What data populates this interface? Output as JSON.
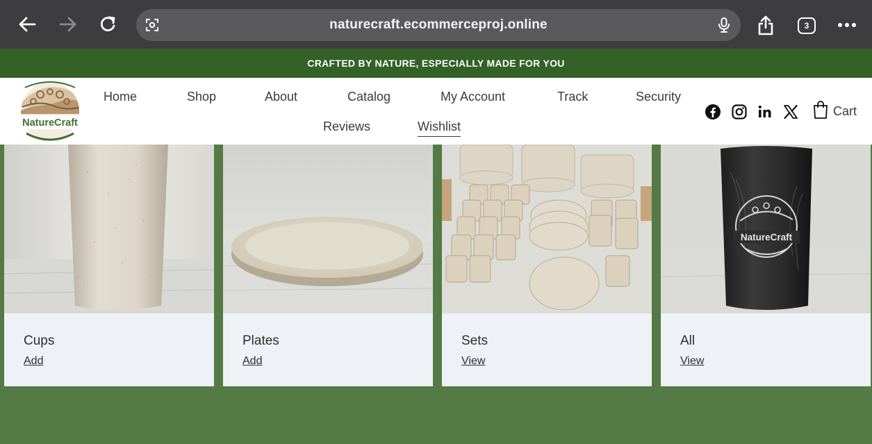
{
  "browser": {
    "url": "naturecraft.ecommerceproj.online",
    "tab_count": "3",
    "icons": [
      "back-arrow-icon",
      "forward-arrow-icon",
      "reload-icon",
      "site-settings-icon",
      "microphone-icon",
      "share-icon",
      "tabs-icon",
      "more-icon"
    ]
  },
  "announcement": {
    "text": "CRAFTED BY NATURE, ESPECIALLY MADE FOR YOU",
    "background": "#336128"
  },
  "header": {
    "logo_text": "NatureCraft",
    "nav": [
      "Home",
      "Shop",
      "About",
      "Catalog",
      "My Account",
      "Track",
      "Security",
      "Reviews",
      "Wishlist"
    ],
    "active_nav": "Wishlist",
    "social_icons": [
      "facebook-icon",
      "instagram-icon",
      "linkedin-icon",
      "x-icon"
    ],
    "cart_label": "Cart"
  },
  "products": [
    {
      "title": "Cups",
      "action": "Add"
    },
    {
      "title": "Plates",
      "action": "Add"
    },
    {
      "title": "Sets",
      "action": "View"
    },
    {
      "title": "All",
      "action": "View"
    }
  ],
  "colors": {
    "brand_green": "#336128",
    "grid_background": "#547a45",
    "card_background": "#eef2f6",
    "browser_chrome": "#3d3d3f"
  }
}
